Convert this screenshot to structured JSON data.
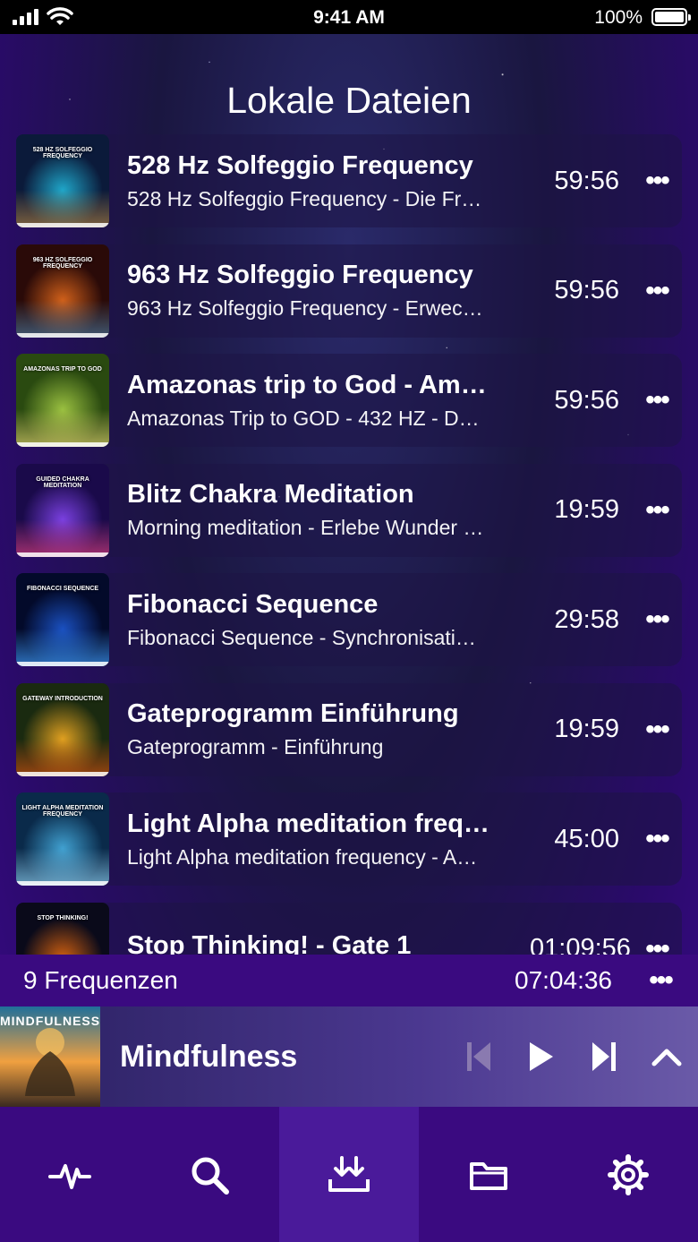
{
  "status": {
    "time": "9:41 AM",
    "battery": "100%"
  },
  "title": "Lokale Dateien",
  "tracks": [
    {
      "title": "528 Hz Solfeggio Frequency",
      "subtitle": "528 Hz Solfeggio Frequency - Die Fr…",
      "duration": "59:56",
      "thumb_caption": "528 HZ SOLFEGGIO FREQUENCY",
      "colors": [
        "#0b1a3a",
        "#1fa6c9",
        "#b08040"
      ]
    },
    {
      "title": "963 Hz Solfeggio Frequency",
      "subtitle": "963 Hz Solfeggio Frequency - Erwec…",
      "duration": "59:56",
      "thumb_caption": "963 HZ SOLFEGGIO FREQUENCY",
      "colors": [
        "#2a0a08",
        "#d0601a",
        "#4a7aa0"
      ]
    },
    {
      "title": "Amazonas trip to God - Am…",
      "subtitle": "Amazonas Trip to GOD - 432 HZ - D…",
      "duration": "59:56",
      "thumb_caption": "AMAZONAS TRIP TO GOD",
      "colors": [
        "#2a4a10",
        "#9ac040",
        "#e0d070"
      ]
    },
    {
      "title": "Blitz Chakra Meditation",
      "subtitle": "Morning meditation - Erlebe Wunder …",
      "duration": "19:59",
      "thumb_caption": "GUIDED CHAKRA MEDITATION",
      "colors": [
        "#1a0a4a",
        "#7a40e0",
        "#e04080"
      ]
    },
    {
      "title": "Fibonacci Sequence",
      "subtitle": "Fibonacci Sequence - Synchronisati…",
      "duration": "29:58",
      "thumb_caption": "FIBONACCI SEQUENCE",
      "colors": [
        "#030a2a",
        "#1a50c0",
        "#40a0ff"
      ]
    },
    {
      "title": "Gateprogramm Einführung",
      "subtitle": "Gateprogramm - Einführung",
      "duration": "19:59",
      "thumb_caption": "GATEWAY INTRODUCTION",
      "colors": [
        "#1a2a10",
        "#e0a020",
        "#d05010"
      ]
    },
    {
      "title": "Light Alpha meditation freq…",
      "subtitle": "Light Alpha meditation frequency - A…",
      "duration": "45:00",
      "thumb_caption": "LIGHT ALPHA MEDITATION FREQUENCY",
      "colors": [
        "#0a2a4a",
        "#40a0d0",
        "#90d0f0"
      ]
    },
    {
      "title": "Stop Thinking! - Gate 1",
      "subtitle": "",
      "duration": "01:09:56",
      "thumb_caption": "STOP THINKING!",
      "colors": [
        "#0a0a1a",
        "#d06010",
        "#402010"
      ]
    }
  ],
  "summary": {
    "count": "9 Frequenzen",
    "total": "07:04:36"
  },
  "player": {
    "title": "Mindfulness",
    "art_caption": "MINDFULNESS"
  },
  "tabs": [
    {
      "icon": "pulse-icon"
    },
    {
      "icon": "search-icon"
    },
    {
      "icon": "downloads-icon",
      "active": true
    },
    {
      "icon": "folder-icon"
    },
    {
      "icon": "settings-gear-icon"
    }
  ]
}
